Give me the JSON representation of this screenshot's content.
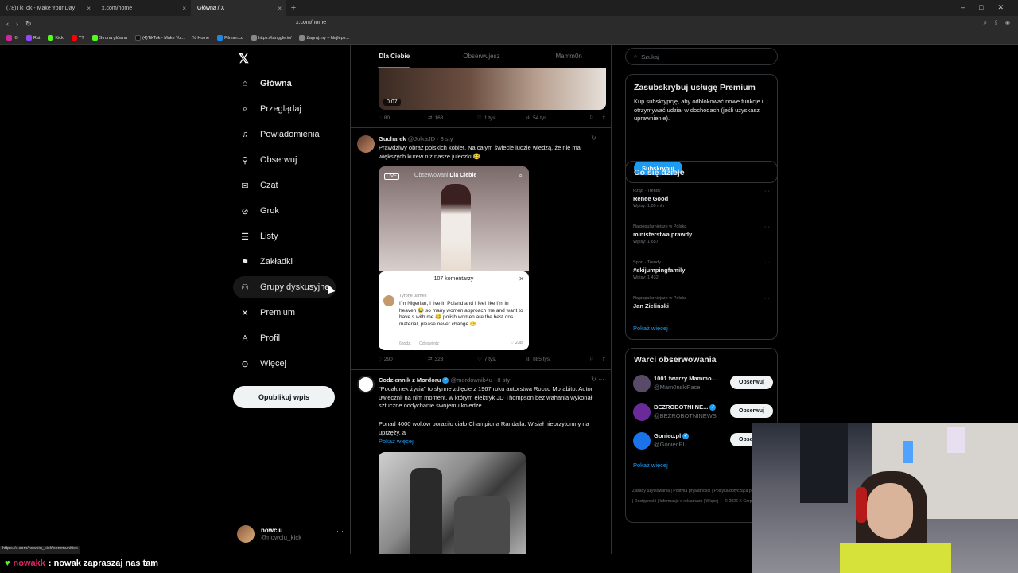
{
  "browser": {
    "tabs": [
      {
        "label": "(78)TikTok - Make Your Day",
        "active": false
      },
      {
        "label": "x.com/home",
        "active": false
      },
      {
        "label": "Główna / X",
        "active": true
      }
    ],
    "url": "x.com/home",
    "bookmarks": [
      "IG",
      "Rat",
      "Kick",
      "YT",
      "Strona główna",
      "(4)TikTok - Make Yo...",
      "Home",
      "Filman.cc",
      "https://tanggle.io/",
      "Zagraj.my – Najleps..."
    ],
    "status_url": "https://x.com/nowciu_kick/communities"
  },
  "nav": {
    "items": [
      {
        "label": "Główna",
        "icon": "home-icon"
      },
      {
        "label": "Przeglądaj",
        "icon": "search-icon"
      },
      {
        "label": "Powiadomienia",
        "icon": "bell-icon"
      },
      {
        "label": "Obserwuj",
        "icon": "person-add-icon"
      },
      {
        "label": "Czat",
        "icon": "mail-icon"
      },
      {
        "label": "Grok",
        "icon": "grok-icon"
      },
      {
        "label": "Listy",
        "icon": "list-icon"
      },
      {
        "label": "Zakładki",
        "icon": "bookmark-icon"
      },
      {
        "label": "Grupy dyskusyjne",
        "icon": "communities-icon"
      },
      {
        "label": "Premium",
        "icon": "x-icon"
      },
      {
        "label": "Profil",
        "icon": "profile-icon"
      },
      {
        "label": "Więcej",
        "icon": "more-icon"
      }
    ],
    "publish_label": "Opublikuj wpis",
    "profile": {
      "name": "nowciu",
      "handle": "@nowciu_kick"
    }
  },
  "timeline": {
    "tabs": [
      "Dla Ciebie",
      "Obserwujesz",
      "Mamm0n"
    ],
    "top_video_time": "0:07",
    "top_actions": {
      "replies": "80",
      "reposts": "168",
      "likes": "1 tys.",
      "views": "54 tys."
    },
    "post1": {
      "name": "Gucharek",
      "handle": "@JolkaJD",
      "time": "8 sty",
      "text": "Prawdziwy obraz polskich kobiet. Na całym świecie ludzie wiedzą, że nie ma większych kurew niż nasze juleczki 😂",
      "media_tabs_a": "Obserwowani",
      "media_tabs_b": "Dla Ciebie",
      "live": "LIVE",
      "comments_count": "107 komentarzy",
      "comment_user": "Tyrone James",
      "comment_text": "I'm Nigerian, I live in Poland and I feel like I'm in heaven 😂 so many women approach me and want to have s with me 😂 polish women are the best ons material, please never change 😁",
      "comment_time": "6godz.",
      "comment_reply": "Odpowiedz",
      "comment_likes": "238",
      "actions": {
        "replies": "290",
        "reposts": "323",
        "likes": "7 tys.",
        "views": "885 tys."
      }
    },
    "post2": {
      "name": "Codziennik z Mordoru",
      "handle": "@mordownik4u",
      "time": "8 sty",
      "text1": "\"Pocałunek życia\" to słynne zdjęcie z 1967 roku autorstwa Rocco Morabito. Autor uwiecznił na nim moment, w którym elektryk JD Thompson bez wahania wykonał sztuczne oddychanie swojemu koledze.",
      "text2": "Ponad 4000 woltów poraziło ciało Championa Randalla. Wisiał nieprzytomny na uprzęży, a",
      "show_more": "Pokaż więcej"
    }
  },
  "right": {
    "search_placeholder": "Szukaj",
    "premium": {
      "title": "Zasubskrybuj usługę Premium",
      "text": "Kup subskrypcję, aby odblokować nowe funkcje i otrzymywać udział w dochodach (jeśli uzyskasz uprawnienie).",
      "button": "Subskrybuj"
    },
    "trends_title": "Co się dzieje",
    "trends": [
      {
        "meta": "Rząd · Trendy",
        "name": "Renee Good",
        "count": "Wpisy: 1,09 mln"
      },
      {
        "meta": "Najpopularniejsze w Polska",
        "name": "ministerstwa prawdy",
        "count": "Wpisy: 1 657"
      },
      {
        "meta": "Sport · Trendy",
        "name": "#skijumpingfamily",
        "count": "Wpisy: 1 432"
      },
      {
        "meta": "Najpopularniejsze w Polska",
        "name": "Jan Zieliński",
        "count": ""
      }
    ],
    "trends_more": "Pokaż więcej",
    "follow_title": "Warci obserwowania",
    "follows": [
      {
        "name": "1001 twarzy Mammo...",
        "handle": "@Mam0nskiFace",
        "button": "Obserwuj",
        "color": "#5a4a6a"
      },
      {
        "name": "BEZROBOTNI NE...",
        "handle": "@BEZROBOTNINEWS",
        "button": "Obserwuj",
        "color": "#6a2a9a"
      },
      {
        "name": "Goniec.pl",
        "handle": "@GoniecPL",
        "button": "Obserwuj",
        "color": "#1a73e8"
      }
    ],
    "follow_more": "Pokaż więcej",
    "footer": "Zasady użytkowania | Polityka prywatności | Polityka dotycząca plików cookie | Dostępność | Informacje o reklamach | Więcej ··· © 2026 X Corp."
  },
  "chat": {
    "user": "nowakk",
    "message": ": nowak zapraszaj nas tam"
  }
}
